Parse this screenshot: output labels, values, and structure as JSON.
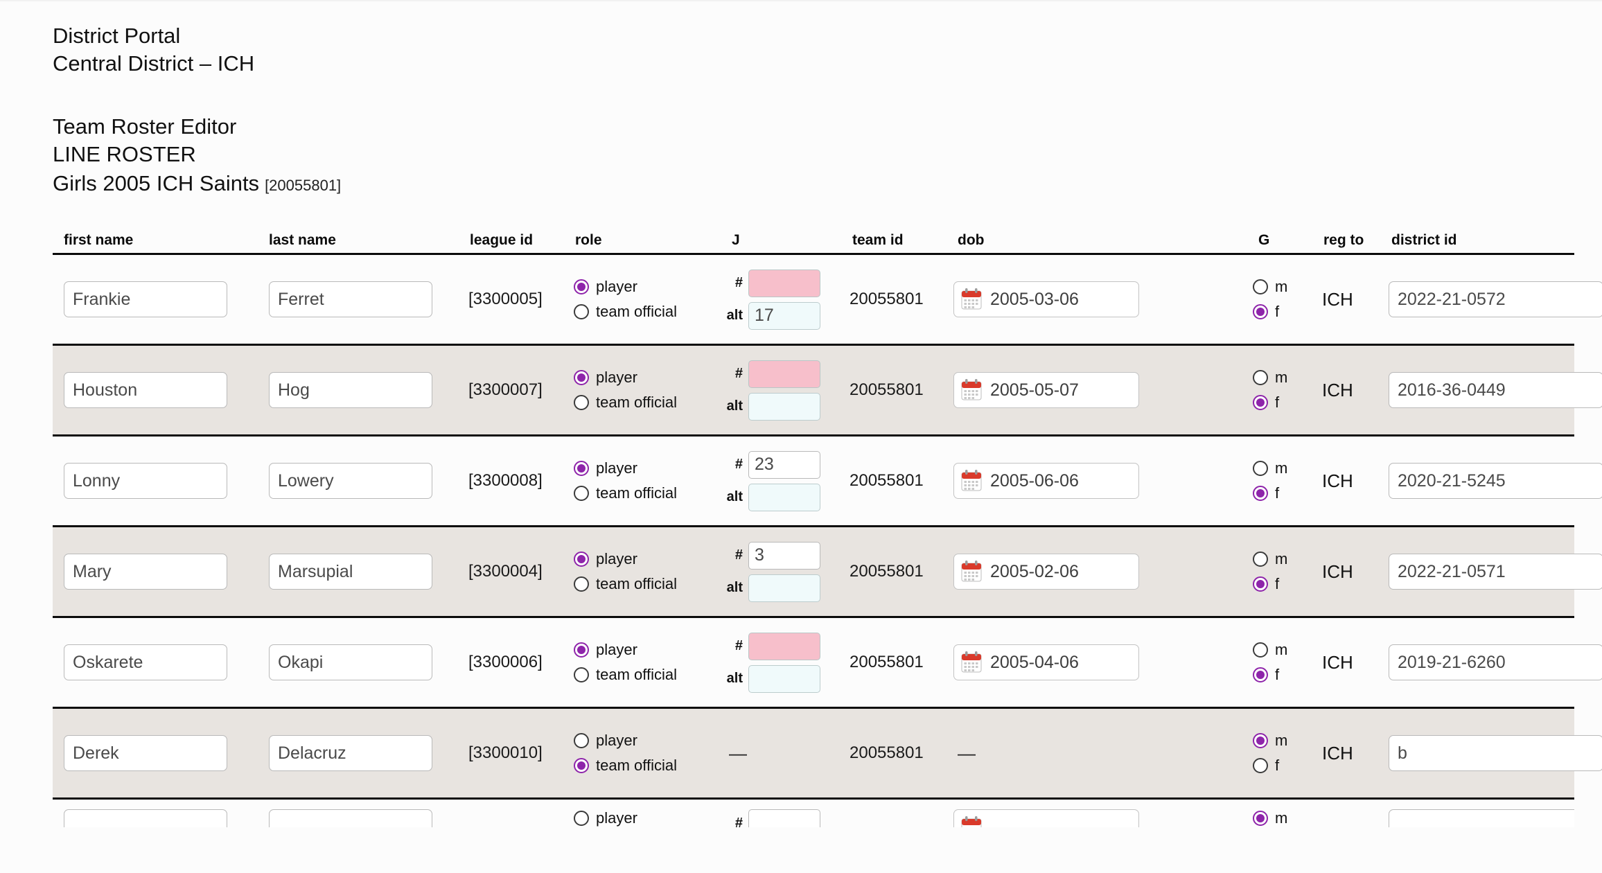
{
  "header": {
    "portal_title": "District Portal",
    "portal_subtitle": "Central District – ICH",
    "editor_title": "Team Roster Editor",
    "roster_label": "LINE ROSTER",
    "team_name": "Girls 2005 ICH Saints",
    "team_id_bracketed": "[20055801]"
  },
  "columns": {
    "first_name": "first name",
    "last_name": "last name",
    "league_id": "league id",
    "role": "role",
    "jersey": "J",
    "team_id": "team id",
    "dob": "dob",
    "gender": "G",
    "reg_to": "reg to",
    "district_id": "district id"
  },
  "labels": {
    "role_player": "player",
    "role_team_official": "team official",
    "jersey_number": "#",
    "jersey_alt": "alt",
    "gender_m": "m",
    "gender_f": "f",
    "empty_dash": "—"
  },
  "colors": {
    "accent_radio": "#8e24aa",
    "error_field": "#f7bfcb",
    "alt_field": "#f0fafb",
    "row_alt_bg": "#e8e4e0",
    "calendar_icon": "#d93a2b"
  },
  "rows": [
    {
      "first_name": "Frankie",
      "last_name": "Ferret",
      "league_id": "[3300005]",
      "role": "player",
      "jersey_number": "",
      "jersey_number_state": "error",
      "jersey_alt": "17",
      "team_id": "20055801",
      "dob": "2005-03-06",
      "gender": "f",
      "reg_to": "ICH",
      "district_id": "2022-21-0572",
      "striped": false
    },
    {
      "first_name": "Houston",
      "last_name": "Hog",
      "league_id": "[3300007]",
      "role": "player",
      "jersey_number": "",
      "jersey_number_state": "error",
      "jersey_alt": "",
      "team_id": "20055801",
      "dob": "2005-05-07",
      "gender": "f",
      "reg_to": "ICH",
      "district_id": "2016-36-0449",
      "striped": true
    },
    {
      "first_name": "Lonny",
      "last_name": "Lowery",
      "league_id": "[3300008]",
      "role": "player",
      "jersey_number": "23",
      "jersey_number_state": "normal",
      "jersey_alt": "",
      "team_id": "20055801",
      "dob": "2005-06-06",
      "gender": "f",
      "reg_to": "ICH",
      "district_id": "2020-21-5245",
      "striped": false
    },
    {
      "first_name": "Mary",
      "last_name": "Marsupial",
      "league_id": "[3300004]",
      "role": "player",
      "jersey_number": "3",
      "jersey_number_state": "normal",
      "jersey_alt": "",
      "team_id": "20055801",
      "dob": "2005-02-06",
      "gender": "f",
      "reg_to": "ICH",
      "district_id": "2022-21-0571",
      "striped": true
    },
    {
      "first_name": "Oskarete",
      "last_name": "Okapi",
      "league_id": "[3300006]",
      "role": "player",
      "jersey_number": "",
      "jersey_number_state": "error",
      "jersey_alt": "",
      "team_id": "20055801",
      "dob": "2005-04-06",
      "gender": "f",
      "reg_to": "ICH",
      "district_id": "2019-21-6260",
      "striped": false
    },
    {
      "first_name": "Derek",
      "last_name": "Delacruz",
      "league_id": "[3300010]",
      "role": "team official",
      "jersey_number": null,
      "jersey_number_state": "none",
      "jersey_alt": null,
      "team_id": "20055801",
      "dob": null,
      "gender": "m",
      "reg_to": "ICH",
      "district_id": "b",
      "striped": true
    },
    {
      "first_name": "",
      "last_name": "",
      "league_id": "",
      "role": "",
      "jersey_number": "",
      "jersey_number_state": "normal",
      "jersey_alt": "",
      "team_id": "",
      "dob": "",
      "gender": "m",
      "reg_to": "",
      "district_id": "",
      "striped": false,
      "clipped": true
    }
  ]
}
